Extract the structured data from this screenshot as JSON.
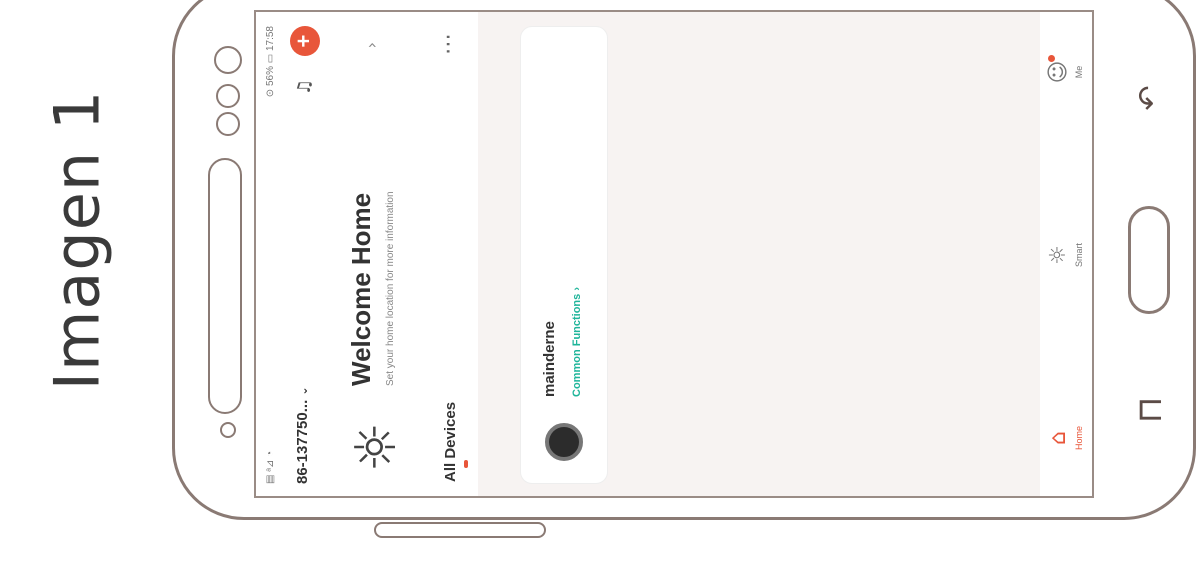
{
  "caption": "Imagen 1",
  "status_bar": {
    "left": "▤ ᵃ⊿ ◔",
    "right": "⊙ 56% ▭ 17:58"
  },
  "header": {
    "home_name": "86-137750...",
    "home_dropdown_icon": "chevron-down-icon",
    "mic_icon": "microphone-icon",
    "add_label": "+"
  },
  "welcome": {
    "title": "Welcome Home",
    "subtitle": "Set your home location for more information",
    "icon": "sun-icon",
    "chevron": "›"
  },
  "tabs": {
    "all_devices": "All Devices",
    "more": "⋯"
  },
  "device": {
    "name": "mainderne",
    "function": "Common Functions ›"
  },
  "tabbar": {
    "home_label": "Home",
    "smart_label": "Smart",
    "me_label": "Me",
    "accent": "#e8563a"
  },
  "hardware": {
    "back_icon": "back-arrow-icon",
    "recent_icon": "recent-apps-icon"
  },
  "colors": {
    "accent": "#e8563a",
    "function": "#1fb59a",
    "outline": "#8a7a74"
  }
}
